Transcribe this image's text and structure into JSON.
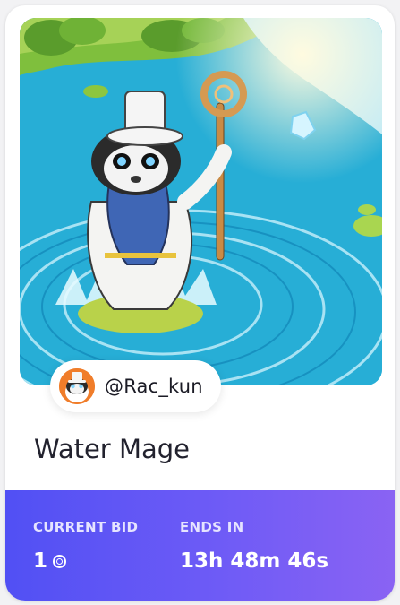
{
  "nft": {
    "title": "Water Mage",
    "creator": "@Rac_kun",
    "artwork_icon": "raccoon-water-mage-artwork",
    "avatar_icon": "raccoon-avatar"
  },
  "auction": {
    "bid_label": "CURRENT BID",
    "bid_value": "1",
    "currency_icon": "coin-icon",
    "ends_label": "ENDS IN",
    "ends_value": "13h 48m 46s"
  },
  "colors": {
    "footer_gradient_start": "#5150f4",
    "footer_gradient_end": "#8a63f3",
    "water": "#2ab3d8",
    "card_bg": "#ffffff"
  }
}
